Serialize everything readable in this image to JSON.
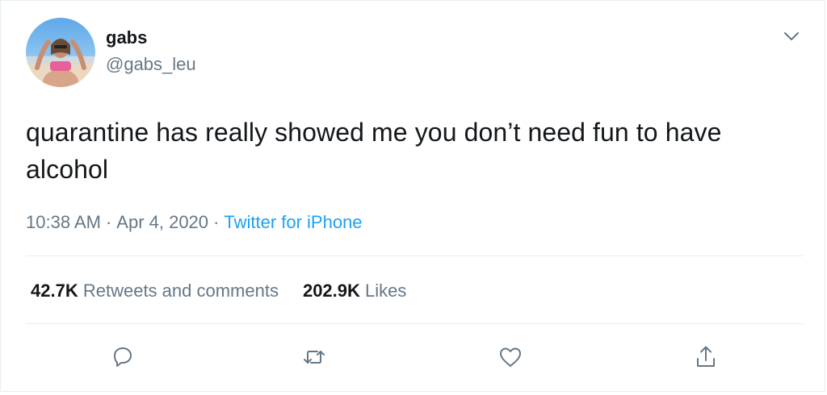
{
  "user": {
    "display_name": "gabs",
    "handle": "@gabs_leu",
    "avatar_icon": "profile-photo-icon"
  },
  "tweet": {
    "text": "quarantine has really showed me you don’t need fun to have alcohol",
    "time": "10:38 AM",
    "date": "Apr 4, 2020",
    "source": "Twitter for iPhone",
    "separator": "·"
  },
  "stats": {
    "retweets_count": "42.7K",
    "retweets_label": "Retweets and comments",
    "likes_count": "202.9K",
    "likes_label": "Likes"
  },
  "actions": [
    {
      "icon": "reply-icon"
    },
    {
      "icon": "retweet-icon"
    },
    {
      "icon": "like-icon"
    },
    {
      "icon": "share-icon"
    }
  ],
  "colors": {
    "text": "#14171a",
    "secondary": "#657786",
    "link": "#1da1f2",
    "divider": "#e6ecf0"
  }
}
